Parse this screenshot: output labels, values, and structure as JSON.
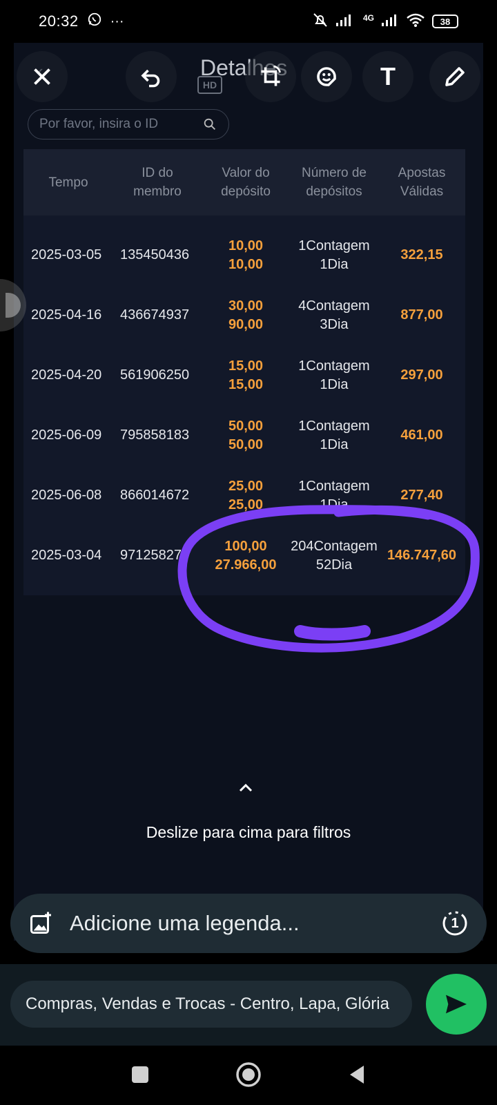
{
  "status_bar": {
    "time": "20:32",
    "network": "4G",
    "battery": "38"
  },
  "app": {
    "title": "Detalhes",
    "search_placeholder": "Por favor, insira o ID"
  },
  "table": {
    "headers": [
      [
        "Tempo",
        ""
      ],
      [
        "ID do",
        "membro"
      ],
      [
        "Valor do",
        "depósito"
      ],
      [
        "Número de",
        "depósitos"
      ],
      [
        "Apostas",
        "Válidas"
      ]
    ],
    "rows": [
      {
        "date": "2025-03-05",
        "member_id": "135450436",
        "deposit_first": "10,00",
        "deposit_total": "10,00",
        "count": "1Contagem",
        "days": "1Dia",
        "valid_bets": "322,15"
      },
      {
        "date": "2025-04-16",
        "member_id": "436674937",
        "deposit_first": "30,00",
        "deposit_total": "90,00",
        "count": "4Contagem",
        "days": "3Dia",
        "valid_bets": "877,00"
      },
      {
        "date": "2025-04-20",
        "member_id": "561906250",
        "deposit_first": "15,00",
        "deposit_total": "15,00",
        "count": "1Contagem",
        "days": "1Dia",
        "valid_bets": "297,00"
      },
      {
        "date": "2025-06-09",
        "member_id": "795858183",
        "deposit_first": "50,00",
        "deposit_total": "50,00",
        "count": "1Contagem",
        "days": "1Dia",
        "valid_bets": "461,00"
      },
      {
        "date": "2025-06-08",
        "member_id": "866014672",
        "deposit_first": "25,00",
        "deposit_total": "25,00",
        "count": "1Contagem",
        "days": "1Dia",
        "valid_bets": "277,40"
      },
      {
        "date": "2025-03-04",
        "member_id": "97125827",
        "deposit_first": "100,00",
        "deposit_total": "27.966,00",
        "count": "204Contagem",
        "days": "52Dia",
        "valid_bets": "146.747,60"
      }
    ]
  },
  "swipe_hint": "Deslize para cima para filtros",
  "editor": {
    "tools": [
      "close-icon",
      "undo-icon",
      "hd-icon",
      "crop-rotate-icon",
      "sticker-icon",
      "text-icon",
      "pencil-icon"
    ],
    "hd_label": "HD",
    "text_tool_label": "T",
    "annotation_color": "#7b3ff5"
  },
  "caption": {
    "placeholder": "Adicione uma legenda...",
    "view_once_label": "1"
  },
  "recipient": {
    "name": "Compras, Vendas e Trocas - Centro, Lapa, Glória"
  },
  "colors": {
    "accent_orange": "#f5a03c",
    "send_green": "#21c063"
  }
}
